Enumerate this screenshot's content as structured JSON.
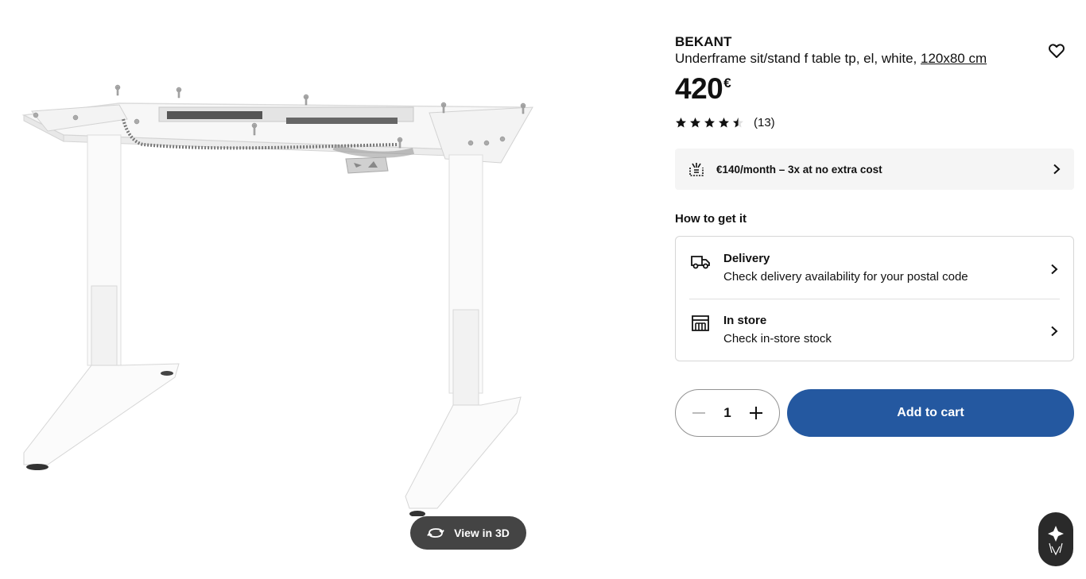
{
  "product": {
    "brand": "BEKANT",
    "description": "Underframe sit/stand f table tp, el, white, ",
    "size_link": "120x80 cm",
    "price": "420",
    "currency": "€",
    "rating_stars": 4.5,
    "review_count": "(13)"
  },
  "media": {
    "view_3d_label": "View in 3D"
  },
  "installment": {
    "text": "€140/month – 3x at no extra cost"
  },
  "fulfilment": {
    "heading": "How to get it",
    "delivery": {
      "title": "Delivery",
      "subtitle": "Check delivery availability for your postal code"
    },
    "store": {
      "title": "In store",
      "subtitle": "Check in-store stock"
    }
  },
  "cart": {
    "quantity": "1",
    "add_label": "Add to cart"
  },
  "colors": {
    "accent_blue": "#2458a0",
    "button_dark": "#444444",
    "panel_grey": "#f5f5f5"
  }
}
